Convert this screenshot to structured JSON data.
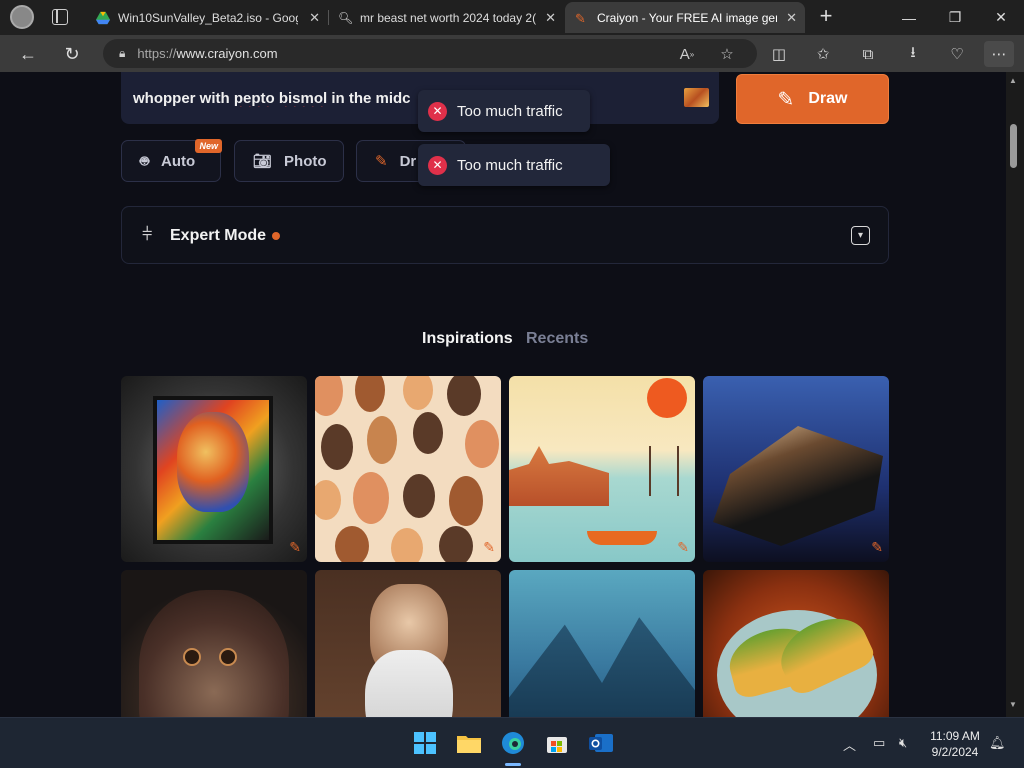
{
  "browser": {
    "tabs": [
      {
        "title": "Win10SunValley_Beta2.iso - Goog",
        "active": false
      },
      {
        "title": "mr beast net worth 2024 today 2(",
        "active": false
      },
      {
        "title": "Craiyon - Your FREE AI image gen",
        "active": true
      }
    ],
    "new_tab_label": "+",
    "window_controls": {
      "minimize": "—",
      "maximize": "❐",
      "close": "✕"
    },
    "url_scheme": "https://",
    "url_host": "www.craiyon.com"
  },
  "page": {
    "prompt_text_a": "whopper with ",
    "prompt_text_b": "pepto",
    "prompt_text_c": " ",
    "prompt_text_d": "bismol",
    "prompt_text_e": " in the midc",
    "draw_label": "Draw",
    "modes": [
      {
        "label": "Auto",
        "icon": "robot-icon",
        "badge": "New"
      },
      {
        "label": "Photo",
        "icon": "camera-icon"
      },
      {
        "label": "Dr",
        "icon": "pencil-icon"
      }
    ],
    "toasts": [
      "Too much traffic",
      "Too much traffic"
    ],
    "expert_mode_label": "Expert Mode",
    "gallery_tabs": {
      "inspirations": "Inspirations",
      "recents": "Recents"
    },
    "gallery_active": "Inspirations"
  },
  "taskbar": {
    "time": "11:09 AM",
    "date": "9/2/2024"
  },
  "colors": {
    "accent": "#e0662a",
    "page_bg": "#0d0e16",
    "toast_error": "#e0304a"
  }
}
